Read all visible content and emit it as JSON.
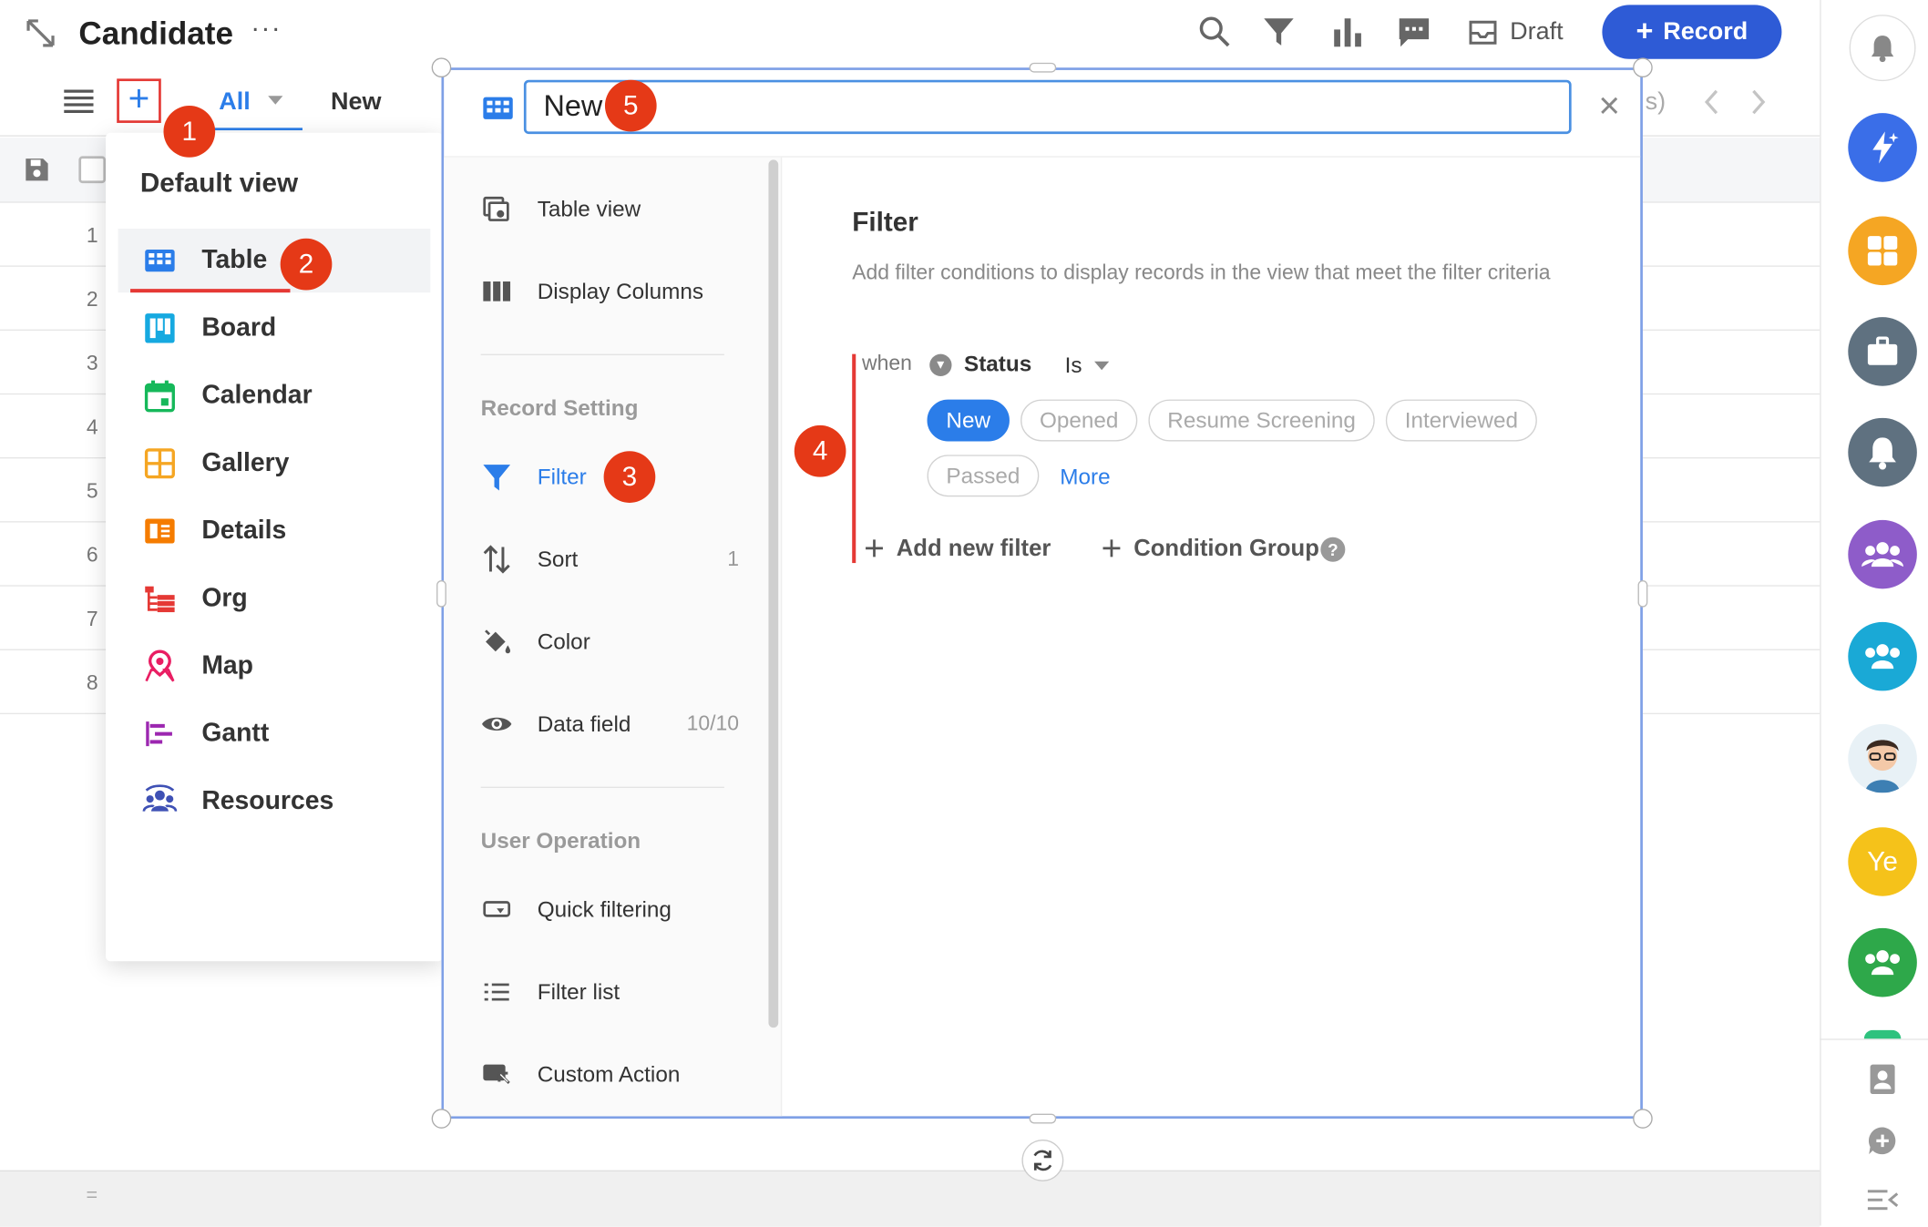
{
  "header": {
    "title": "Candidate",
    "more": "···",
    "draft_label": "Draft",
    "record_button": "Record",
    "record_plus": "+"
  },
  "viewbar": {
    "add_view": "+",
    "tab_all": "All",
    "tab_new": "New",
    "partial_right": "s)"
  },
  "table": {
    "row_numbers": [
      "1",
      "2",
      "3",
      "4",
      "5",
      "6",
      "7",
      "8"
    ]
  },
  "dropdown": {
    "title": "Default view",
    "items": [
      {
        "label": "Table",
        "icon": "table-icon",
        "color": "#2b7de9"
      },
      {
        "label": "Board",
        "icon": "board-icon",
        "color": "#16a9e0"
      },
      {
        "label": "Calendar",
        "icon": "calendar-icon",
        "color": "#16b85a"
      },
      {
        "label": "Gallery",
        "icon": "gallery-icon",
        "color": "#f5a623"
      },
      {
        "label": "Details",
        "icon": "details-icon",
        "color": "#f57c00"
      },
      {
        "label": "Org",
        "icon": "org-icon",
        "color": "#e53935"
      },
      {
        "label": "Map",
        "icon": "map-icon",
        "color": "#e91e63"
      },
      {
        "label": "Gantt",
        "icon": "gantt-icon",
        "color": "#9c27b0"
      },
      {
        "label": "Resources",
        "icon": "resources-icon",
        "color": "#3f51b5"
      }
    ]
  },
  "modal": {
    "view_name": "New",
    "close": "×",
    "menu": {
      "table_view": "Table view",
      "display_columns": "Display Columns",
      "record_setting_heading": "Record Setting",
      "filter": "Filter",
      "sort": "Sort",
      "sort_count": "1",
      "color": "Color",
      "data_field": "Data field",
      "data_field_count": "10/10",
      "user_operation_heading": "User Operation",
      "quick_filtering": "Quick filtering",
      "filter_list": "Filter list",
      "custom_action": "Custom Action"
    },
    "filter": {
      "title": "Filter",
      "description": "Add filter conditions to display records in the view that meet the filter criteria",
      "when": "when",
      "field": "Status",
      "operator": "Is",
      "options": [
        "New",
        "Opened",
        "Resume Screening",
        "Interviewed",
        "Passed"
      ],
      "selected": "New",
      "more": "More",
      "add_new_filter": "Add new filter",
      "condition_group": "Condition Group",
      "help": "?"
    }
  },
  "markers": [
    "1",
    "2",
    "3",
    "4",
    "5"
  ],
  "sidebar": {
    "avatar_initials": "Ye"
  },
  "colors": {
    "accent": "#2b7de9",
    "record_button": "#2e5bd6",
    "marker": "#e53917",
    "highlight": "#e53935"
  }
}
